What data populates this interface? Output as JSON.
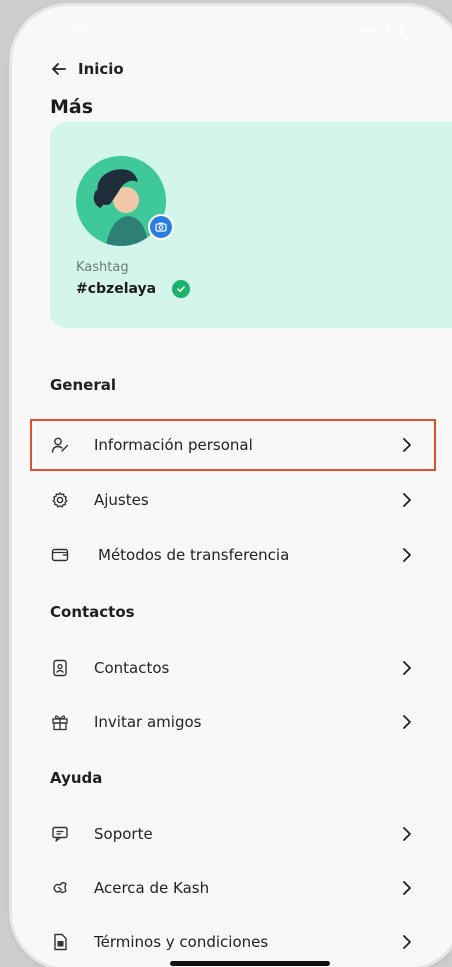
{
  "status": {
    "time": "9:41",
    "icons": "▪▪ ◔ ▮"
  },
  "nav": {
    "back_label": "Inicio"
  },
  "page": {
    "title": "Más"
  },
  "profile": {
    "kashtag_label": "Kashtag",
    "kashtag_value": "#cbzelaya",
    "card_color": "#d3f5ec",
    "avatar_color": "#3fc89a"
  },
  "sections": {
    "general": "General",
    "contactos": "Contactos",
    "ayuda": "Ayuda"
  },
  "items": {
    "info_personal": "Información personal",
    "ajustes": "Ajustes",
    "metodos": "Métodos de transferencia",
    "contactos": "Contactos",
    "invitar": "Invitar amigos",
    "soporte": "Soporte",
    "acerca": "Acerca de Kash",
    "terminos": "Términos y condiciones"
  },
  "colors": {
    "highlight": "#e1502d",
    "verified": "#19b46a",
    "camera": "#2a7de0"
  }
}
